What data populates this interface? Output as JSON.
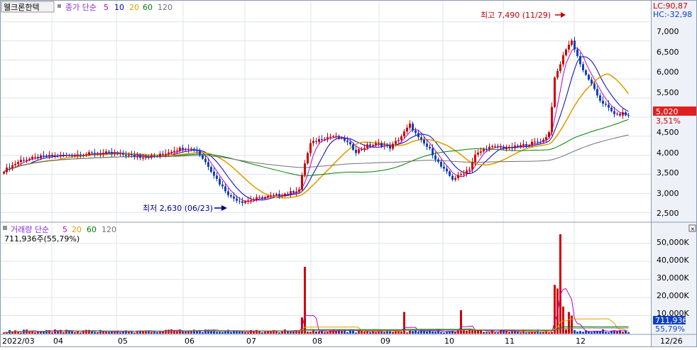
{
  "stock_name": "웰크론한텍",
  "price_legend": {
    "label": "종가 단순",
    "periods": [
      {
        "text": "5",
        "color": "#c000c0"
      },
      {
        "text": "10",
        "color": "#0000c0"
      },
      {
        "text": "20",
        "color": "#e0a000"
      },
      {
        "text": "60",
        "color": "#008000"
      },
      {
        "text": "120",
        "color": "#707070"
      }
    ]
  },
  "volume_legend": {
    "label": "거래량 단순",
    "periods": [
      {
        "text": "5",
        "color": "#c000c0"
      },
      {
        "text": "20",
        "color": "#e0a000"
      },
      {
        "text": "60",
        "color": "#008000"
      },
      {
        "text": "120",
        "color": "#707070"
      }
    ],
    "current_volume": "711,936주(55,79%)"
  },
  "top_right_info": {
    "lc": "LC:90,87",
    "hc": "HC:-32,98"
  },
  "price_badge": {
    "price": "5,020",
    "change": "3,51%"
  },
  "volume_badge": {
    "volume": "711,936",
    "percent": "55,79%"
  },
  "annotations": {
    "high": "최고 7,490 (11/29)",
    "low": "최저 2,630 (06/23)"
  },
  "x_axis_labels": [
    "2022/03",
    "04",
    "05",
    "06",
    "07",
    "08",
    "09",
    "10",
    "11",
    "12",
    "12/26"
  ],
  "price_axis_labels": [
    "7,000",
    "6,500",
    "6,000",
    "5,500",
    "5,000",
    "4,500",
    "4,000",
    "3,500",
    "3,000",
    "2,500"
  ],
  "volume_axis_labels": [
    "50,000K",
    "40,000K",
    "30,000K",
    "20,000K",
    "10,000K"
  ],
  "colors": {
    "up": "#d00000",
    "down": "#1040c0"
  },
  "chart_data": {
    "type": "candlestick",
    "price_axis": {
      "ylim": [
        2300,
        7700
      ],
      "ticks": [
        2500,
        3000,
        3500,
        4000,
        4500,
        5000,
        5500,
        6000,
        6500,
        7000,
        7500
      ]
    },
    "volume_axis": {
      "ylim": [
        0,
        55000
      ],
      "unit": "K",
      "ticks": [
        10000,
        20000,
        30000,
        40000,
        50000
      ]
    },
    "high": {
      "value": 7490,
      "date": "11/29"
    },
    "low": {
      "value": 2630,
      "date": "06/23"
    },
    "last": {
      "price": 5020,
      "change_pct": 3.51,
      "volume": 711936
    },
    "close_keypoints": [
      [
        0,
        3600
      ],
      [
        6,
        3870
      ],
      [
        14,
        3970
      ],
      [
        22,
        4000
      ],
      [
        30,
        4040
      ],
      [
        36,
        4060
      ],
      [
        42,
        4020
      ],
      [
        48,
        3960
      ],
      [
        54,
        3980
      ],
      [
        60,
        4140
      ],
      [
        64,
        4200
      ],
      [
        68,
        4120
      ],
      [
        72,
        3720
      ],
      [
        76,
        3260
      ],
      [
        80,
        2900
      ],
      [
        84,
        2780
      ],
      [
        88,
        2850
      ],
      [
        92,
        2900
      ],
      [
        96,
        2950
      ],
      [
        100,
        3000
      ],
      [
        104,
        3100
      ],
      [
        106,
        3800
      ],
      [
        108,
        4300
      ],
      [
        112,
        4450
      ],
      [
        116,
        4500
      ],
      [
        120,
        4400
      ],
      [
        124,
        4100
      ],
      [
        128,
        4250
      ],
      [
        132,
        4300
      ],
      [
        136,
        4200
      ],
      [
        140,
        4500
      ],
      [
        143,
        4800
      ],
      [
        146,
        4450
      ],
      [
        150,
        4150
      ],
      [
        154,
        3700
      ],
      [
        158,
        3380
      ],
      [
        160,
        3450
      ],
      [
        164,
        3650
      ],
      [
        166,
        4000
      ],
      [
        170,
        4200
      ],
      [
        174,
        4220
      ],
      [
        178,
        4180
      ],
      [
        182,
        4250
      ],
      [
        186,
        4320
      ],
      [
        190,
        4400
      ],
      [
        192,
        4600
      ],
      [
        194,
        6000
      ],
      [
        196,
        6400
      ],
      [
        198,
        6800
      ],
      [
        200,
        7000
      ],
      [
        202,
        6600
      ],
      [
        204,
        6200
      ],
      [
        206,
        6000
      ],
      [
        208,
        5700
      ],
      [
        210,
        5450
      ],
      [
        212,
        5300
      ],
      [
        214,
        5150
      ],
      [
        216,
        5050
      ],
      [
        218,
        5100
      ],
      [
        220,
        5020
      ]
    ],
    "volume_spikes": [
      [
        106,
        37000
      ],
      [
        105,
        9000
      ],
      [
        141,
        12000
      ],
      [
        161,
        13000
      ],
      [
        194,
        27000
      ],
      [
        195,
        25000
      ],
      [
        196,
        55000
      ],
      [
        197,
        15000
      ],
      [
        199,
        12000
      ],
      [
        200,
        10000
      ]
    ]
  }
}
